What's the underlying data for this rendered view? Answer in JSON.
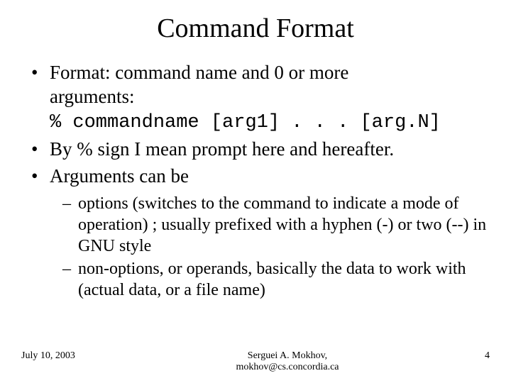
{
  "title": "Command Format",
  "bullets": {
    "b1_line1": "Format: command name and 0 or more",
    "b1_line2": "arguments:",
    "b1_code": "% commandname [arg1] . . . [arg.N]",
    "b2": "By % sign I mean prompt here and hereafter.",
    "b3": "Arguments can be",
    "sub1": "options (switches to the command to indicate a mode of operation) ; usually prefixed with a hyphen (-) or two (--) in GNU style",
    "sub2": "non-options, or operands, basically the data to work with (actual data, or a file name)"
  },
  "footer": {
    "date": "July 10, 2003",
    "author_line1": "Serguei A. Mokhov,",
    "author_line2": "mokhov@cs.concordia.ca",
    "page": "4"
  }
}
